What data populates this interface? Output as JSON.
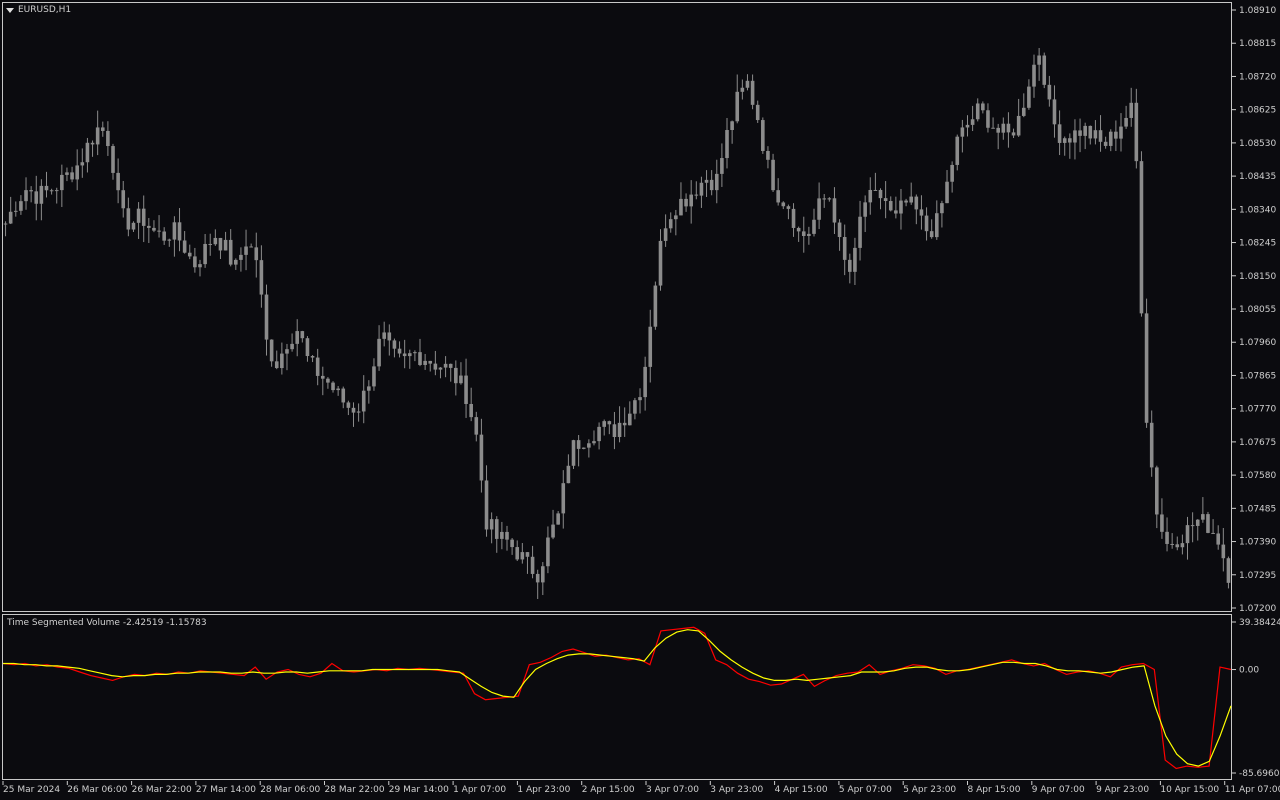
{
  "chart_window": {
    "symbol_title": "EURUSD,H1",
    "indicator_title": "Time Segmented Volume -2.42519 -1.15783"
  },
  "colors": {
    "background": "#0b0b0f",
    "candle": "#8c8c8c",
    "tsv_line": "#ff0000",
    "signal_line": "#ffff00",
    "axis_text": "#cfcfcf",
    "frame": "#c8c8c8"
  },
  "chart_data": [
    {
      "type": "candlestick",
      "price_ticks": [
        "1.08910",
        "1.08815",
        "1.08720",
        "1.08625",
        "1.08530",
        "1.08435",
        "1.08340",
        "1.08245",
        "1.08150",
        "1.08055",
        "1.07960",
        "1.07865",
        "1.07770",
        "1.07675",
        "1.07580",
        "1.07485",
        "1.07390",
        "1.07295",
        "1.07200"
      ],
      "ylim": [
        1.072,
        1.0891
      ],
      "time_ticks": [
        "25 Mar 2024",
        "26 Mar 06:00",
        "26 Mar 22:00",
        "27 Mar 14:00",
        "28 Mar 06:00",
        "28 Mar 22:00",
        "29 Mar 14:00",
        "1 Apr 07:00",
        "1 Apr 23:00",
        "2 Apr 15:00",
        "3 Apr 07:00",
        "3 Apr 23:00",
        "4 Apr 15:00",
        "5 Apr 07:00",
        "5 Apr 23:00",
        "8 Apr 15:00",
        "9 Apr 07:00",
        "9 Apr 23:00",
        "10 Apr 15:00",
        "11 Apr 07:00"
      ],
      "close_path": [
        1.083,
        1.0836,
        1.084,
        1.0838,
        1.0839,
        1.0841,
        1.0844,
        1.0847,
        1.0853,
        1.0858,
        1.0853,
        1.0832,
        1.083,
        1.0832,
        1.0828,
        1.0826,
        1.0828,
        1.0824,
        1.0818,
        1.0822,
        1.0827,
        1.0823,
        1.0817,
        1.0825,
        1.082,
        1.0795,
        1.079,
        1.0797,
        1.08,
        1.079,
        1.0787,
        1.0784,
        1.078,
        1.0777,
        1.0778,
        1.0788,
        1.0798,
        1.0792,
        1.079,
        1.0793,
        1.0792,
        1.079,
        1.0789,
        1.0786,
        1.0782,
        1.077,
        1.0745,
        1.074,
        1.0739,
        1.0736,
        1.0732,
        1.073,
        1.074,
        1.0747,
        1.0765,
        1.0768,
        1.077,
        1.0772,
        1.077,
        1.0774,
        1.0778,
        1.0785,
        1.081,
        1.083,
        1.0835,
        1.0837,
        1.084,
        1.0843,
        1.0842,
        1.0855,
        1.0865,
        1.087,
        1.086,
        1.0845,
        1.0838,
        1.0835,
        1.0826,
        1.0828,
        1.0836,
        1.0838,
        1.082,
        1.0815,
        1.0836,
        1.0837,
        1.0838,
        1.083,
        1.0836,
        1.0834,
        1.0828,
        1.0829,
        1.084,
        1.0853,
        1.0858,
        1.0862,
        1.086,
        1.0856,
        1.0855,
        1.086,
        1.0872,
        1.088,
        1.086,
        1.0855,
        1.0855,
        1.0857,
        1.0855,
        1.0852,
        1.0855,
        1.086,
        1.0863,
        1.078,
        1.075,
        1.0738,
        1.074,
        1.0742,
        1.0745,
        1.0744,
        1.074,
        1.073
      ],
      "point_count": 240
    },
    {
      "type": "line",
      "title": "Time Segmented Volume -2.42519 -1.15783",
      "value_ticks": [
        "39.38424",
        "0.00",
        "-85.69604"
      ],
      "ylim": [
        -85.69604,
        39.38424
      ],
      "series": [
        {
          "name": "TSV",
          "color": "#ff0000",
          "values": [
            5,
            4,
            5,
            3,
            4,
            2,
            1,
            -2,
            -5,
            -7,
            -9,
            -6,
            -4,
            -5,
            -3,
            -4,
            -2,
            -3,
            -1,
            -2,
            -3,
            -4,
            -5,
            2,
            -8,
            -2,
            0,
            -4,
            -6,
            -3,
            5,
            -1,
            -2,
            -1,
            0,
            -1,
            1,
            0,
            1,
            0,
            -1,
            -2,
            -3,
            -20,
            -25,
            -24,
            -23,
            -22,
            4,
            6,
            10,
            15,
            17,
            14,
            11,
            12,
            10,
            8,
            9,
            4,
            32,
            33,
            34,
            35,
            30,
            8,
            4,
            -3,
            -8,
            -10,
            -13,
            -12,
            -8,
            -4,
            -14,
            -9,
            -5,
            -3,
            -2,
            4,
            -4,
            -1,
            1,
            4,
            3,
            1,
            -4,
            -1,
            0,
            2,
            4,
            6,
            8,
            5,
            3,
            5,
            0,
            -4,
            -2,
            -1,
            -3,
            -6,
            2,
            4,
            5,
            0,
            -75,
            -82,
            -80,
            -81,
            -80,
            2,
            0
          ]
        },
        {
          "name": "Signal",
          "color": "#ffff00",
          "values": [
            5,
            5,
            4,
            4,
            3,
            3,
            2,
            1,
            -1,
            -3,
            -5,
            -6,
            -5,
            -5,
            -4,
            -4,
            -3,
            -3,
            -2,
            -2,
            -2,
            -3,
            -3,
            -2,
            -3,
            -3,
            -2,
            -2,
            -3,
            -2,
            -1,
            -1,
            -1,
            -1,
            0,
            0,
            0,
            0,
            0,
            0,
            0,
            -1,
            -2,
            -8,
            -14,
            -19,
            -22,
            -23,
            -10,
            0,
            5,
            9,
            12,
            13,
            13,
            12,
            11,
            10,
            9,
            7,
            18,
            26,
            31,
            33,
            32,
            24,
            15,
            8,
            2,
            -3,
            -7,
            -9,
            -9,
            -8,
            -9,
            -8,
            -7,
            -6,
            -5,
            -2,
            -2,
            -2,
            -1,
            1,
            2,
            2,
            0,
            -1,
            -1,
            0,
            2,
            4,
            6,
            6,
            5,
            5,
            3,
            0,
            -1,
            -1,
            -2,
            -3,
            -2,
            0,
            2,
            3,
            -30,
            -55,
            -70,
            -78,
            -80,
            -76,
            -55,
            -30
          ]
        }
      ]
    }
  ]
}
